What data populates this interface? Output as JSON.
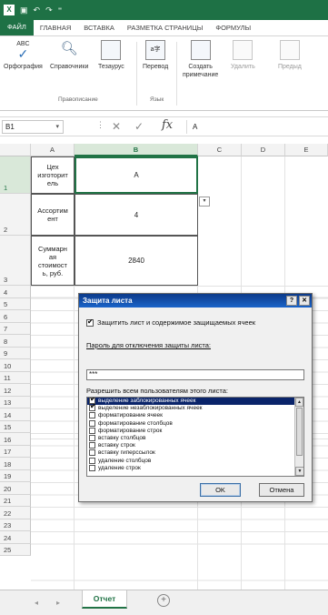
{
  "colors": {
    "accent": "#217346",
    "titlebar": "#1e7145",
    "dialog_title": "#0b3a8a"
  },
  "quick_access": {
    "app_icon": "X",
    "icons": [
      "save-icon",
      "undo-icon",
      "redo-icon"
    ]
  },
  "menu": {
    "tabs": [
      "ФАЙЛ",
      "ГЛАВНАЯ",
      "ВСТАВКА",
      "РАЗМЕТКА СТРАНИЦЫ",
      "ФОРМУЛЫ"
    ]
  },
  "ribbon": {
    "buttons": {
      "spelling": "Орфография",
      "references": "Справочники",
      "thesaurus": "Тезаурус",
      "translate": "Перевод",
      "new_comment_1": "Создать",
      "new_comment_2": "примечание",
      "delete": "Удалить",
      "prev": "Предыд"
    },
    "groups": {
      "proofing": "Правописание",
      "language": "Язык"
    }
  },
  "formula_bar": {
    "name_box": "B1",
    "cancel": "✕",
    "enter": "✓",
    "fx": "fx",
    "value": "A"
  },
  "grid": {
    "columns": [
      "A",
      "B",
      "C",
      "D",
      "E"
    ],
    "rows": [
      "1",
      "2",
      "3",
      "4",
      "5",
      "6",
      "7",
      "8",
      "9",
      "10",
      "11",
      "12",
      "13",
      "14",
      "15",
      "16",
      "17",
      "18",
      "19",
      "20",
      "21",
      "22",
      "23",
      "24",
      "25"
    ],
    "cells": {
      "A1": "Цех изготовитель",
      "A2": "Ассортимент",
      "A3": "Суммарная стоимость, руб.",
      "B1": "A",
      "B2": "4",
      "B3": "2840"
    },
    "a_lines": {
      "A1": [
        "Цех",
        "изготорит",
        "ель"
      ],
      "A2": [
        "Ассортим",
        "ент"
      ],
      "A3": [
        "Суммарн",
        "ая",
        "стоимост",
        "ь, руб."
      ]
    },
    "filter_glyph": "▾"
  },
  "sheets": {
    "active": "Отчет",
    "add": "+",
    "nav_prev": "◂",
    "nav_next": "▸"
  },
  "dialog": {
    "title": "Защита листа",
    "help": "?",
    "close": "✕",
    "protect_label": "Защитить лист и содержимое защищаемых ячеек",
    "protect_checked": true,
    "password_label": "Пароль для отключения защиты листа:",
    "password_value": "***",
    "allow_label": "Разрешить всем пользователям этого листа:",
    "options": [
      {
        "label": "выделение заблокированных ячеек",
        "checked": true
      },
      {
        "label": "выделение незаблокированных ячеек",
        "checked": true
      },
      {
        "label": "форматирование ячеек",
        "checked": false
      },
      {
        "label": "форматирование столбцов",
        "checked": false
      },
      {
        "label": "форматирование строк",
        "checked": false
      },
      {
        "label": "вставку столбцов",
        "checked": false
      },
      {
        "label": "вставку строк",
        "checked": false
      },
      {
        "label": "вставку гиперссылок",
        "checked": false
      },
      {
        "label": "удаление столбцов",
        "checked": false
      },
      {
        "label": "удаление строк",
        "checked": false
      }
    ],
    "ok": "OK",
    "cancel": "Отмена"
  }
}
